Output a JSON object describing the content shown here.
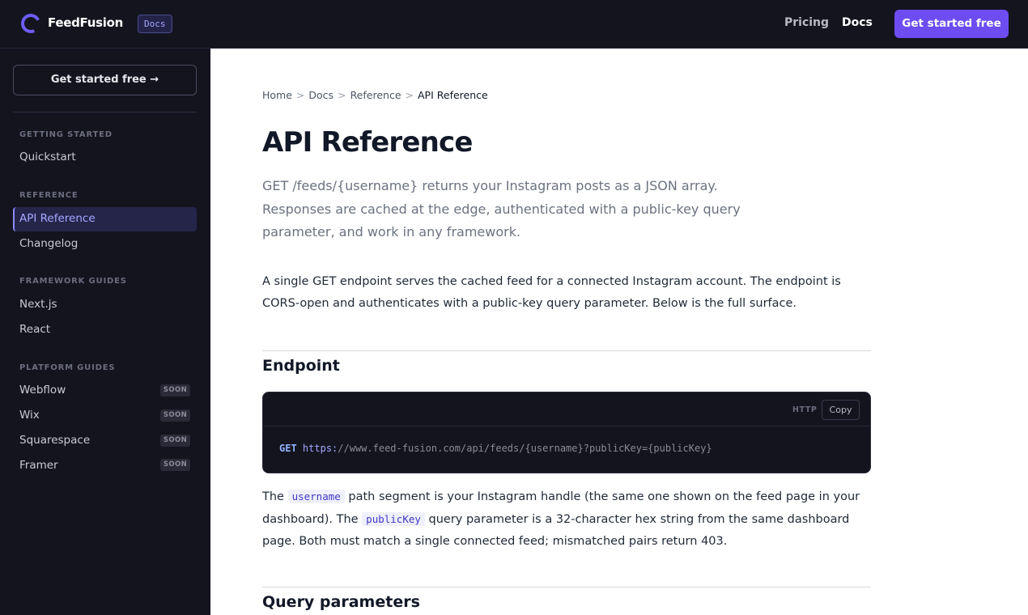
{
  "header": {
    "brand": "FeedFusion",
    "badge": "Docs",
    "nav": [
      "Pricing",
      "Docs"
    ],
    "cta": "Get started free"
  },
  "sidebar": {
    "cta": "Get started free →",
    "sections": [
      {
        "title": "GETTING STARTED",
        "items": [
          {
            "label": "Quickstart"
          }
        ]
      },
      {
        "title": "REFERENCE",
        "items": [
          {
            "label": "API Reference",
            "active": true
          },
          {
            "label": "Changelog"
          }
        ]
      },
      {
        "title": "FRAMEWORK GUIDES",
        "items": [
          {
            "label": "Next.js"
          },
          {
            "label": "React"
          }
        ]
      },
      {
        "title": "PLATFORM GUIDES",
        "items": [
          {
            "label": "Webflow",
            "badge": "SOON"
          },
          {
            "label": "Wix",
            "badge": "SOON"
          },
          {
            "label": "Squarespace",
            "badge": "SOON"
          },
          {
            "label": "Framer",
            "badge": "SOON"
          }
        ]
      }
    ]
  },
  "main": {
    "breadcrumb": [
      "Home",
      "Docs",
      "Reference",
      "API Reference"
    ],
    "title": "API Reference",
    "lead": "GET /feeds/{username} returns your Instagram posts as a JSON array. Responses are cached at the edge, authenticated with a public-key query parameter, and work in any framework.",
    "intro": "A single GET endpoint serves the cached feed for a connected Instagram account. The endpoint is CORS-open and authenticates with a public-key query parameter. Below is the full surface.",
    "endpoint": {
      "heading": "Endpoint",
      "lang": "HTTP",
      "copy": "Copy",
      "method": "GET",
      "scheme": "https:",
      "rest": "//www.feed-fusion.com/api/feeds/{username}?publicKey={publicKey}"
    },
    "param_text": {
      "p1": "The ",
      "code1": "username",
      "p2": " path segment is your Instagram handle (the same one shown on the feed page in your dashboard). The ",
      "code2": "publicKey",
      "p3": " query parameter is a 32-character hex string from the same dashboard page. Both must match a single connected feed; mismatched pairs return 403."
    },
    "next_heading": "Query parameters"
  }
}
